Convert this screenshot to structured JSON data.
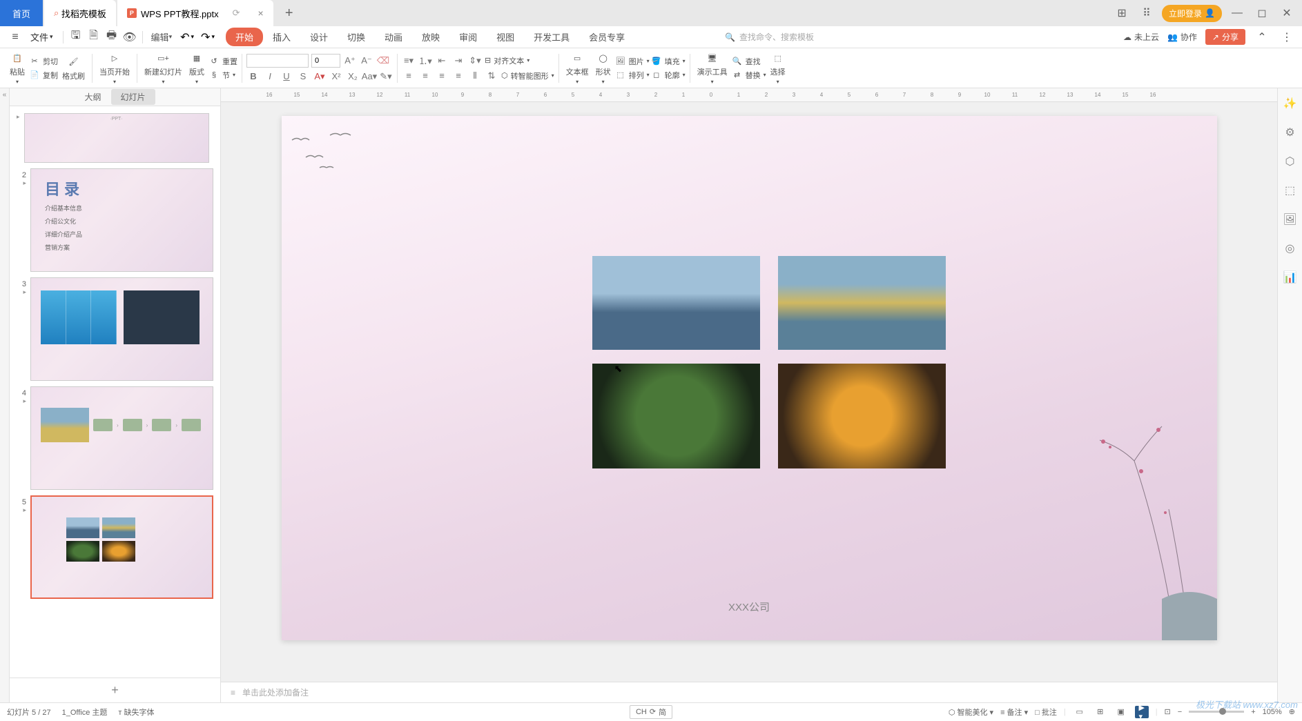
{
  "titlebar": {
    "home": "首页",
    "template": "找稻壳模板",
    "filename": "WPS PPT教程.pptx",
    "login": "立即登录"
  },
  "menubar": {
    "file": "文件",
    "edit": "编辑",
    "tabs": [
      "开始",
      "插入",
      "设计",
      "切换",
      "动画",
      "放映",
      "审阅",
      "视图",
      "开发工具",
      "会员专享"
    ],
    "search_placeholder": "查找命令、搜索模板",
    "cloud": "未上云",
    "collab": "协作",
    "share": "分享"
  },
  "ribbon": {
    "paste": "粘贴",
    "cut": "剪切",
    "copy": "复制",
    "format_painter": "格式刷",
    "current_page": "当页开始",
    "new_slide": "新建幻灯片",
    "layout": "版式",
    "reset": "重置",
    "section": "节",
    "font_size": "0",
    "align_text": "对齐文本",
    "smart_shape": "转智能图形",
    "text_box": "文本框",
    "shape": "形状",
    "picture": "图片",
    "arrange": "排列",
    "fill": "填充",
    "outline": "轮廓",
    "demo_tools": "演示工具",
    "find": "查找",
    "replace": "替换",
    "select": "选择"
  },
  "slide_panel": {
    "tab_outline": "大纲",
    "tab_slides": "幻灯片",
    "slide2_title": "目录",
    "slide2_items": [
      "介绍基本信息",
      "介绍公文化",
      "详细介绍产品",
      "营销方案"
    ]
  },
  "canvas": {
    "company": "XXX公司"
  },
  "notes": {
    "placeholder": "单击此处添加备注"
  },
  "statusbar": {
    "slide_info": "幻灯片 5 / 27",
    "theme": "1_Office 主题",
    "missing_font": "缺失字体",
    "ime": "CH",
    "ime2": "简",
    "beautify": "智能美化",
    "notes": "备注",
    "comments": "批注",
    "zoom": "105%"
  },
  "watermark": "极光下载站 www.xz7.com"
}
